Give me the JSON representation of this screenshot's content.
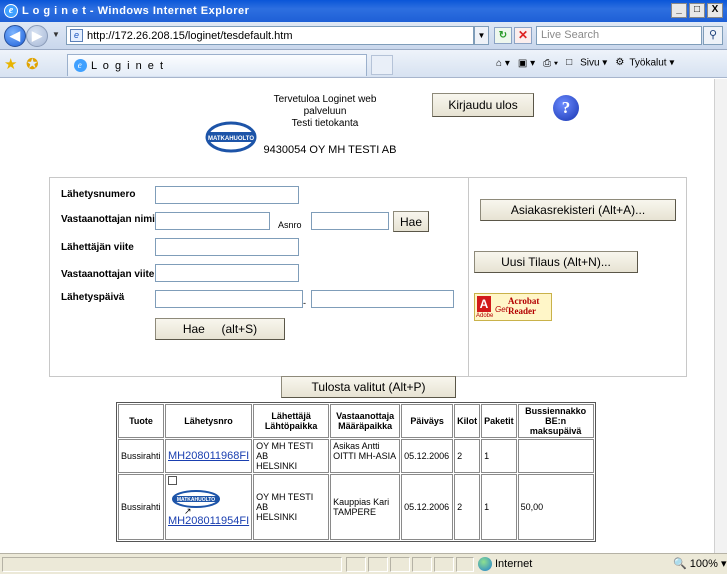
{
  "window": {
    "title": "L o g i n e t - Windows Internet Explorer",
    "buttons": [
      "_",
      "□",
      "X"
    ]
  },
  "addressbar": {
    "url": "http://172.26.208.15/loginet/tesdefault.htm",
    "search_placeholder": "Live Search"
  },
  "tabbar": {
    "tab_title": "L o g i n e t",
    "sivu_label": "Sivu",
    "tyokalut_label": "Työkalut"
  },
  "header": {
    "logo_text": "MATKAHUOLTO",
    "welcome_line1": "Tervetuloa Loginet web palveluun",
    "welcome_line2": "Testi tietokanta",
    "logout_label": "Kirjaudu ulos",
    "help_label": "?",
    "company": "9430054 OY MH TESTI AB"
  },
  "form": {
    "fields": {
      "lahetysnumero": {
        "label": "Lähetysnumero",
        "value": ""
      },
      "vastaanottajan_nimi": {
        "label": "Vastaanottajan nimi",
        "value": ""
      },
      "asnro": {
        "label": "Asnro",
        "value": ""
      },
      "lahettajan_viite": {
        "label": "Lähettäjän viite",
        "value": ""
      },
      "vastaanottajan_viite": {
        "label": "Vastaanottajan viite",
        "value": ""
      },
      "lahetyspaiva": {
        "label": "Lähetyspäivä",
        "value_from": "",
        "value_to": ""
      }
    },
    "range_separator": "-",
    "hae_small_label": "Hae",
    "hae_label": "Hae     (alt+S)"
  },
  "side": {
    "asiakasrekisteri_label": "Asiakasrekisteri (Alt+A)...",
    "uusi_tilaus_label": "Uusi Tilaus (Alt+N)...",
    "acrobat_get": "Get",
    "acrobat_name": "Acrobat Reader",
    "acrobat_brand": "Adobe"
  },
  "results": {
    "print_label": "Tulosta valitut (Alt+P)",
    "headers": {
      "tuote": "Tuote",
      "lahetysnro": "Lähetysnro",
      "lahettaja": "Lähettäjä",
      "lahtopaikka": "Lähtöpaikka",
      "vastaanottaja": "Vastaanottaja",
      "maarapaikka": "Määräpaikka",
      "paivays": "Päiväys",
      "kilot": "Kilot",
      "paketit": "Paketit",
      "bussiennakko": "Bussiennakko",
      "be_maksupaiva": "BE:n maksupäivä"
    },
    "rows": [
      {
        "tuote": "Bussirahti",
        "lahetysnro": "MH208011968FI",
        "lahettaja": "OY MH TESTI AB",
        "lahtopaikka": "HELSINKI",
        "vastaanottaja": "Asikas Antti",
        "maarapaikka": "OITTI MH-ASIA",
        "paivays": "05.12.2006",
        "kilot": "2",
        "paketit": "1",
        "bussiennakko": ""
      },
      {
        "tuote": "Bussirahti",
        "lahetysnro": "MH208011954FI",
        "lahettaja": "OY MH TESTI AB",
        "lahtopaikka": "HELSINKI",
        "vastaanottaja": "Kauppias Kari",
        "maarapaikka": "TAMPERE",
        "paivays": "05.12.2006",
        "kilot": "2",
        "paketit": "1",
        "bussiennakko": "50,00"
      }
    ]
  },
  "statusbar": {
    "zone": "Internet",
    "zoom": "100%"
  }
}
